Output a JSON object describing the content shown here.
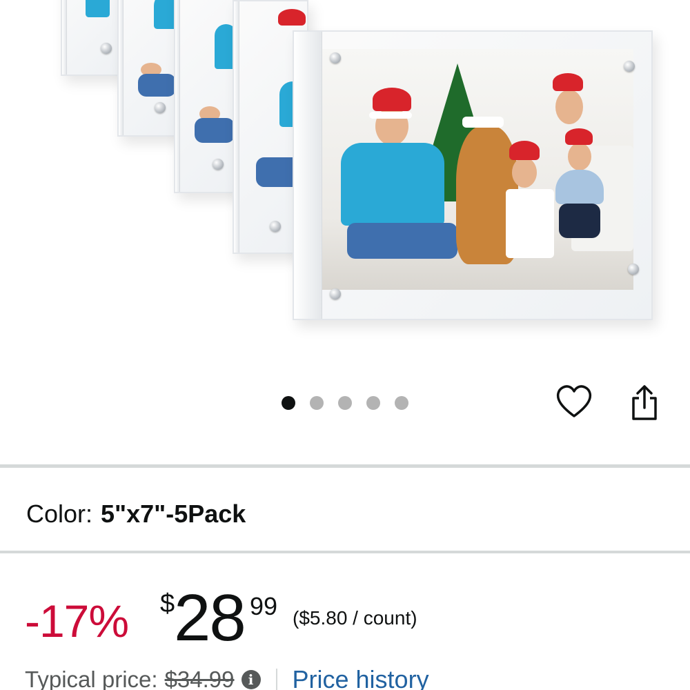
{
  "product_image": {
    "alt": "5 acrylic magnetic photo frames showing a family photo with Christmas hats",
    "carousel": {
      "total": 5,
      "active_index": 0
    }
  },
  "actions": {
    "favorite_icon": "heart-outline-icon",
    "share_icon": "share-icon"
  },
  "variation": {
    "label": "Color:",
    "value": "5\"x7\"-5Pack"
  },
  "price": {
    "discount": "-17%",
    "currency_symbol": "$",
    "whole": "28",
    "fraction": "99",
    "unit_price": "($5.80 / count)",
    "typical_label": "Typical price:",
    "typical_value": "$34.99",
    "info_glyph": "i",
    "history_link": "Price history"
  },
  "colors": {
    "discount": "#cc0c39",
    "link": "#2162a1",
    "text": "#0f1111",
    "muted": "#565959",
    "divider": "#d5d9d9"
  }
}
